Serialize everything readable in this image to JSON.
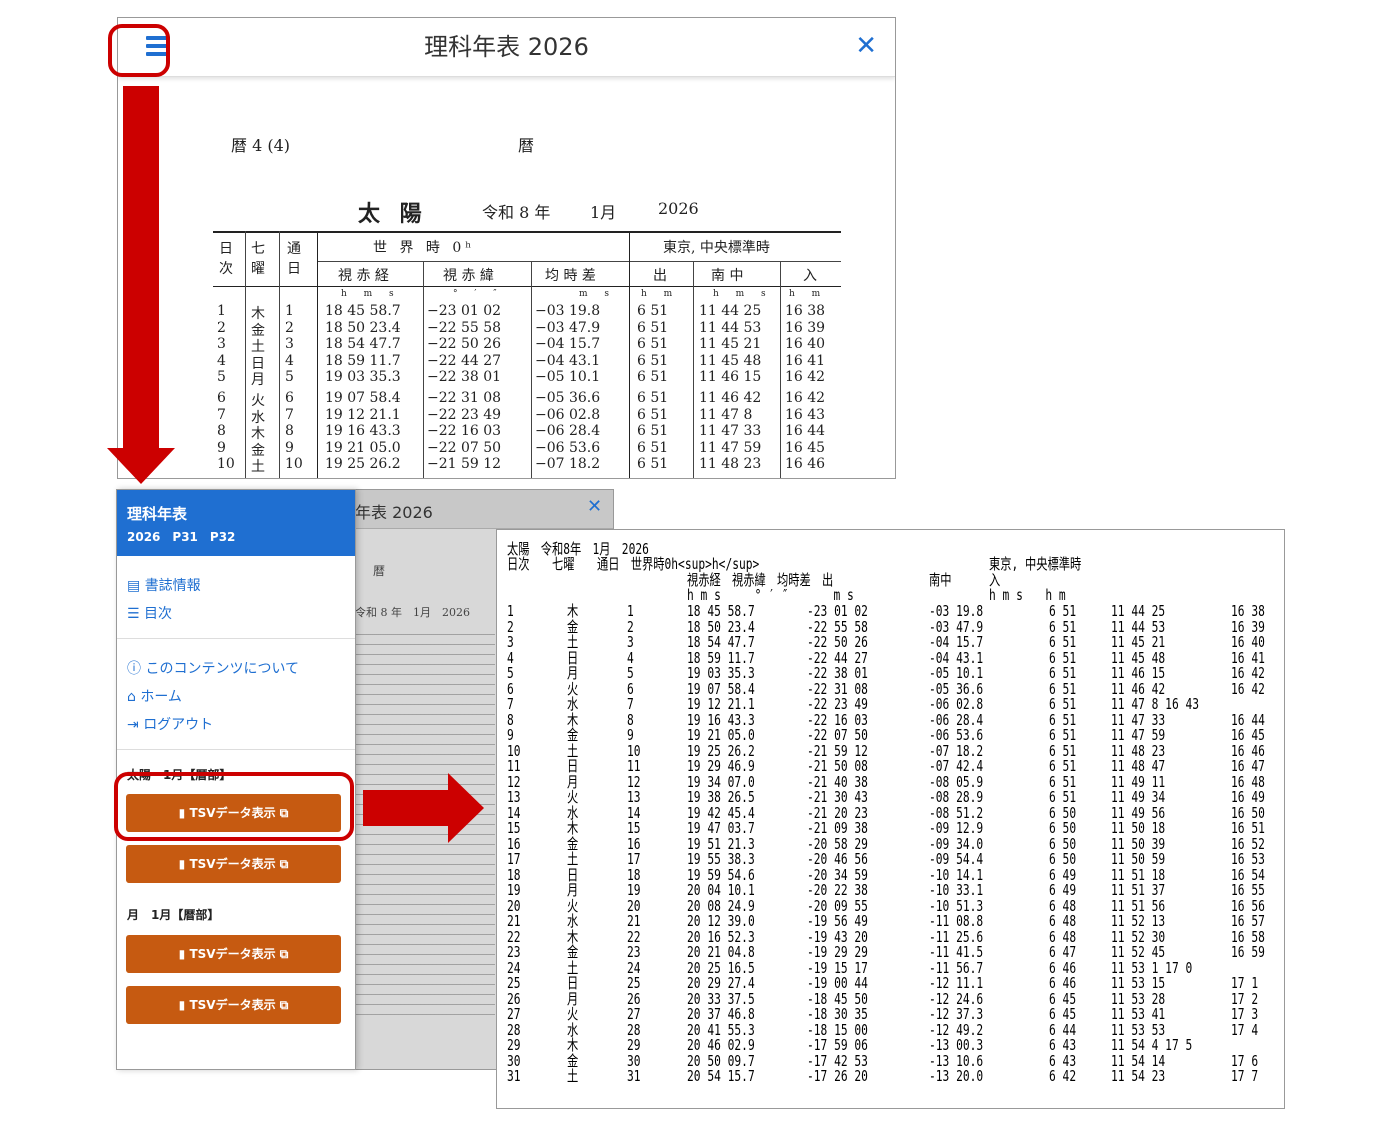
{
  "top_viewer": {
    "title": "理科年表 2026",
    "scan": {
      "page_label": "暦 4 (4)",
      "section_label": "暦",
      "table_title": "太 陽",
      "era": "令和 8 年",
      "month": "1月",
      "year": "2026",
      "header_groups": [
        "世 界 時 0ʰ",
        "東京, 中央標準時"
      ],
      "col_headers": [
        "日次",
        "七曜",
        "通日",
        "視 赤 経",
        "視 赤 緯",
        "均 時 差",
        "出",
        "南 中",
        "入"
      ],
      "units": [
        "h m s",
        "° ′ ″",
        "m s",
        "h m",
        "h m s",
        "h m"
      ],
      "rows": [
        [
          "1",
          "木",
          "1",
          "18 45 58.7",
          "−23 01 02",
          "−03 19.8",
          "6 51",
          "11 44 25",
          "16 38"
        ],
        [
          "2",
          "金",
          "2",
          "18 50 23.4",
          "−22 55 58",
          "−03 47.9",
          "6 51",
          "11 44 53",
          "16 39"
        ],
        [
          "3",
          "土",
          "3",
          "18 54 47.7",
          "−22 50 26",
          "−04 15.7",
          "6 51",
          "11 45 21",
          "16 40"
        ],
        [
          "4",
          "日",
          "4",
          "18 59 11.7",
          "−22 44 27",
          "−04 43.1",
          "6 51",
          "11 45 48",
          "16 41"
        ],
        [
          "5",
          "月",
          "5",
          "19 03 35.3",
          "−22 38 01",
          "−05 10.1",
          "6 51",
          "11 46 15",
          "16 42"
        ],
        [
          "6",
          "火",
          "6",
          "19 07 58.4",
          "−22 31 08",
          "−05 36.6",
          "6 51",
          "11 46 42",
          "16 42"
        ],
        [
          "7",
          "水",
          "7",
          "19 12 21.1",
          "−22 23 49",
          "−06 02.8",
          "6 51",
          "11 47 8",
          "16 43"
        ],
        [
          "8",
          "木",
          "8",
          "19 16 43.3",
          "−22 16 03",
          "−06 28.4",
          "6 51",
          "11 47 33",
          "16 44"
        ],
        [
          "9",
          "金",
          "9",
          "19 21 05.0",
          "−22 07 50",
          "−06 53.6",
          "6 51",
          "11 47 59",
          "16 45"
        ],
        [
          "10",
          "土",
          "10",
          "19 25 26.2",
          "−21 59 12",
          "−07 18.2",
          "6 51",
          "11 48 23",
          "16 46"
        ]
      ]
    }
  },
  "sidebar": {
    "title": "理科年表",
    "subtitle": "2026　P31　P32",
    "links": [
      {
        "icon": "book-icon",
        "label": "書誌情報"
      },
      {
        "icon": "list-icon",
        "label": "目次"
      },
      {
        "icon": "info-icon",
        "label": "このコンテンツについて"
      },
      {
        "icon": "home-icon",
        "label": "ホーム"
      },
      {
        "icon": "logout-icon",
        "label": "ログアウト"
      }
    ],
    "sections": [
      {
        "label": "太陽　1月【暦部】",
        "buttons": [
          "TSVデータ表示",
          "TSVデータ表示"
        ]
      },
      {
        "label": "月　1月【暦部】",
        "buttons": [
          "TSVデータ表示",
          "TSVデータ表示"
        ]
      }
    ]
  },
  "mid_viewer": {
    "title_fragment": "年表 2026",
    "section_label": "暦",
    "header_fragment": "令和 8 年　1月　2026"
  },
  "tsv_view": {
    "line1": "太陽　令和8年　1月　2026",
    "line2_a": "日次　　七曜　　通日　世界時0h<sup>h</sup>",
    "line2_b": "東京, 中央標準時",
    "line3_a": "視赤経　視赤緯　均時差　出",
    "line3_b": "南中",
    "line3_c": "入",
    "line4_a": "h m s　　　° ′ ″　　　　m s",
    "line4_b": "h m s　　h m",
    "days": [
      "1",
      "2",
      "3",
      "4",
      "5",
      "6",
      "7",
      "8",
      "9",
      "10",
      "11",
      "12",
      "13",
      "14",
      "15",
      "16",
      "17",
      "18",
      "19",
      "20",
      "21",
      "22",
      "23",
      "24",
      "25",
      "26",
      "27",
      "28",
      "29",
      "30",
      "31"
    ],
    "weekdays": [
      "木",
      "金",
      "土",
      "日",
      "月",
      "火",
      "水",
      "木",
      "金",
      "土",
      "日",
      "月",
      "火",
      "水",
      "木",
      "金",
      "土",
      "日",
      "月",
      "火",
      "水",
      "木",
      "金",
      "土",
      "日",
      "月",
      "火",
      "水",
      "木",
      "金",
      "土"
    ],
    "ra": [
      "18 45 58.7",
      "18 50 23.4",
      "18 54 47.7",
      "18 59 11.7",
      "19 03 35.3",
      "19 07 58.4",
      "19 12 21.1",
      "19 16 43.3",
      "19 21 05.0",
      "19 25 26.2",
      "19 29 46.9",
      "19 34 07.0",
      "19 38 26.5",
      "19 42 45.4",
      "19 47 03.7",
      "19 51 21.3",
      "19 55 38.3",
      "19 59 54.6",
      "20 04 10.1",
      "20 08 24.9",
      "20 12 39.0",
      "20 16 52.3",
      "20 21 04.8",
      "20 25 16.5",
      "20 29 27.4",
      "20 33 37.5",
      "20 37 46.8",
      "20 41 55.3",
      "20 46 02.9",
      "20 50 09.7",
      "20 54 15.7"
    ],
    "dec": [
      "-23 01 02",
      "-22 55 58",
      "-22 50 26",
      "-22 44 27",
      "-22 38 01",
      "-22 31 08",
      "-22 23 49",
      "-22 16 03",
      "-22 07 50",
      "-21 59 12",
      "-21 50 08",
      "-21 40 38",
      "-21 30 43",
      "-21 20 23",
      "-21 09 38",
      "-20 58 29",
      "-20 46 56",
      "-20 34 59",
      "-20 22 38",
      "-20 09 55",
      "-19 56 49",
      "-19 43 20",
      "-19 29 29",
      "-19 15 17",
      "-19 00 44",
      "-18 45 50",
      "-18 30 35",
      "-18 15 00",
      "-17 59 06",
      "-17 42 53",
      "-17 26 20"
    ],
    "eot": [
      "-03 19.8",
      "-03 47.9",
      "-04 15.7",
      "-04 43.1",
      "-05 10.1",
      "-05 36.6",
      "-06 02.8",
      "-06 28.4",
      "-06 53.6",
      "-07 18.2",
      "-07 42.4",
      "-08 05.9",
      "-08 28.9",
      "-08 51.2",
      "-09 12.9",
      "-09 34.0",
      "-09 54.4",
      "-10 14.1",
      "-10 33.1",
      "-10 51.3",
      "-11 08.8",
      "-11 25.6",
      "-11 41.5",
      "-11 56.7",
      "-12 11.1",
      "-12 24.6",
      "-12 37.3",
      "-12 49.2",
      "-13 00.3",
      "-13 10.6",
      "-13 20.0"
    ],
    "rise": [
      "6 51",
      "6 51",
      "6 51",
      "6 51",
      "6 51",
      "6 51",
      "6 51",
      "6 51",
      "6 51",
      "6 51",
      "6 51",
      "6 51",
      "6 51",
      "6 50",
      "6 50",
      "6 50",
      "6 50",
      "6 49",
      "6 49",
      "6 48",
      "6 48",
      "6 48",
      "6 47",
      "6 46",
      "6 46",
      "6 45",
      "6 45",
      "6 44",
      "6 43",
      "6 43",
      "6 42"
    ],
    "transit": [
      "11 44 25",
      "11 44 53",
      "11 45 21",
      "11 45 48",
      "11 46 15",
      "11 46 42",
      "11 47 8 16 43",
      "11 47 33",
      "11 47 59",
      "11 48 23",
      "11 48 47",
      "11 49 11",
      "11 49 34",
      "11 49 56",
      "11 50 18",
      "11 50 39",
      "11 50 59",
      "11 51 18",
      "11 51 37",
      "11 51 56",
      "11 52 13",
      "11 52 30",
      "11 52 45",
      "11 53 1 17 0",
      "11 53 15",
      "11 53 28",
      "11 53 41",
      "11 53 53",
      "11 54 4 17 5",
      "11 54 14",
      "11 54 23"
    ],
    "set": [
      "16 38",
      "16 39",
      "16 40",
      "16 41",
      "16 42",
      "16 42",
      "",
      "16 44",
      "16 45",
      "16 46",
      "16 47",
      "16 48",
      "16 49",
      "16 50",
      "16 51",
      "16 52",
      "16 53",
      "16 54",
      "16 55",
      "16 56",
      "16 57",
      "16 58",
      "16 59",
      "",
      "17 1",
      "17 2",
      "17 3",
      "17 4",
      "",
      "17 6",
      "17 7"
    ]
  },
  "colors": {
    "accent": "#1f6fd1",
    "button": "#c65a11",
    "highlight": "#cc0000"
  }
}
